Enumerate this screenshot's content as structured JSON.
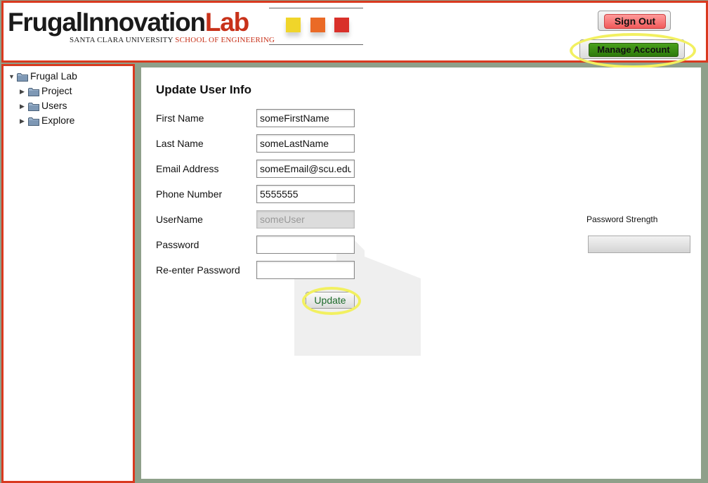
{
  "header": {
    "logo": {
      "name_part1": "FrugalInnovation",
      "name_part2": "Lab",
      "subtitle_university": "SANTA CLARA UNIVERSITY",
      "subtitle_school": "SCHOOL OF ENGINEERING"
    },
    "squares_colors": [
      "#f0d52a",
      "#ea6a26",
      "#d9302a"
    ],
    "sign_out_label": "Sign Out",
    "manage_account_label": "Manage Account"
  },
  "sidebar": {
    "tree": [
      {
        "label": "Frugal Lab",
        "expanded": true,
        "level": 0
      },
      {
        "label": "Project",
        "expanded": false,
        "level": 1
      },
      {
        "label": "Users",
        "expanded": false,
        "level": 1
      },
      {
        "label": "Explore",
        "expanded": false,
        "level": 1
      }
    ]
  },
  "main": {
    "title": "Update User Info",
    "fields": [
      {
        "label": "First Name",
        "value": "someFirstName",
        "disabled": false
      },
      {
        "label": "Last Name",
        "value": "someLastName",
        "disabled": false
      },
      {
        "label": "Email Address",
        "value": "someEmail@scu.edu",
        "disabled": false
      },
      {
        "label": "Phone Number",
        "value": "5555555",
        "disabled": false
      },
      {
        "label": "UserName",
        "value": "someUser",
        "disabled": true
      },
      {
        "label": "Password",
        "value": "",
        "disabled": false
      },
      {
        "label": "Re-enter Password",
        "value": "",
        "disabled": false
      }
    ],
    "update_label": "Update",
    "password_strength_label": "Password Strength"
  },
  "colors": {
    "accent_red": "#d9391f",
    "highlight_yellow": "#f2f060",
    "manage_green": "#2e7a0c",
    "signout_red": "#f05a5a",
    "panel_bg": "#8fa08a"
  }
}
